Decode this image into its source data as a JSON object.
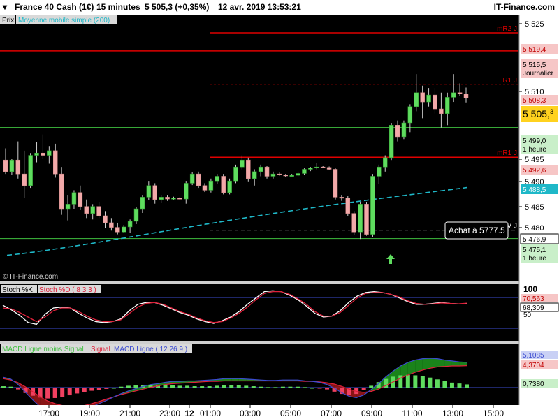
{
  "header": {
    "instrument": "France 40 Cash (1€)",
    "timeframe": "15 minutes",
    "quote": "5 505,3 (+0,35%)",
    "datetime": "12 avr. 2019 13:53:21",
    "brand": "IT-Finance.com"
  },
  "price_panel": {
    "tag": "Prix",
    "indicator_label": "Moyenne mobile simple (200)",
    "watermark": "© IT-Finance.com",
    "buy_label": "Achat à 5777.5",
    "buy_arrow_icon": "up-arrow-icon"
  },
  "stoch_panel": {
    "k_label": "Stoch %K",
    "d_label": "Stoch %D ( 8 3 3 )"
  },
  "macd_panel": {
    "hist_label": "MACD Ligne moins Signal",
    "signal_label": "Signal",
    "macd_label": "MACD Ligne ( 12 26 9 )"
  },
  "colors": {
    "up": "#5fdc5f",
    "down": "#f2a9a9",
    "resistance": "#e00000",
    "support": "#3fbf3f",
    "sma": "#1fb8c8",
    "stoch_k": "#ffffff",
    "stoch_d": "#e0203a",
    "macd_line": "#3b4bd0",
    "macd_signal": "#e0203a",
    "hist_up": "#5fdc5f",
    "hist_down": "#f04060"
  },
  "chart_data": [
    {
      "type": "candlestick",
      "ylim": [
        5470,
        5528
      ],
      "ytick_labels": [
        "5 525",
        "5 510",
        "5 495",
        "5 490",
        "5 485",
        "5 480"
      ],
      "xtick_labels": [
        "17:00",
        "19:00",
        "21:00",
        "23:00",
        "12",
        "01:00",
        "03:00",
        "05:00",
        "07:00",
        "09:00",
        "11:00",
        "13:00",
        "15:00"
      ],
      "candles": [
        [
          5492.0,
          5494.5,
          5489.0,
          5489.5
        ],
        [
          5489.5,
          5492.2,
          5488.8,
          5492.0
        ],
        [
          5492.0,
          5496.0,
          5488.0,
          5489.0
        ],
        [
          5489.0,
          5494.0,
          5483.8,
          5486.5
        ],
        [
          5486.5,
          5493.5,
          5486.0,
          5493.0
        ],
        [
          5493.0,
          5495.8,
          5491.5,
          5493.5
        ],
        [
          5493.5,
          5497.5,
          5492.2,
          5493.0
        ],
        [
          5493.0,
          5495.0,
          5491.2,
          5494.0
        ],
        [
          5494.0,
          5495.5,
          5488.2,
          5489.0
        ],
        [
          5489.0,
          5490.5,
          5480.2,
          5481.5
        ],
        [
          5481.5,
          5484.5,
          5479.0,
          5482.5
        ],
        [
          5482.5,
          5485.5,
          5481.5,
          5485.0
        ],
        [
          5485.0,
          5486.5,
          5481.2,
          5482.0
        ],
        [
          5482.0,
          5483.5,
          5479.5,
          5480.5
        ],
        [
          5480.5,
          5482.5,
          5479.2,
          5482.0
        ],
        [
          5482.0,
          5483.0,
          5479.5,
          5480.0
        ],
        [
          5480.0,
          5481.0,
          5477.4,
          5478.5
        ],
        [
          5478.5,
          5479.5,
          5476.8,
          5477.5
        ],
        [
          5477.5,
          5478.5,
          5476.0,
          5476.5
        ],
        [
          5476.5,
          5478.0,
          5476.4,
          5477.6
        ],
        [
          5477.6,
          5479.2,
          5476.3,
          5478.8
        ],
        [
          5478.8,
          5481.8,
          5478.2,
          5481.5
        ],
        [
          5481.5,
          5484.5,
          5480.6,
          5484.0
        ],
        [
          5484.0,
          5487.5,
          5483.4,
          5486.5
        ],
        [
          5486.5,
          5487.0,
          5482.6,
          5483.5
        ],
        [
          5483.5,
          5484.5,
          5482.8,
          5484.0
        ],
        [
          5484.0,
          5484.5,
          5483.2,
          5483.6
        ],
        [
          5483.6,
          5484.1,
          5483.4,
          5483.8
        ],
        [
          5483.8,
          5484.0,
          5483.5,
          5483.6
        ],
        [
          5483.6,
          5487.5,
          5482.6,
          5487.0
        ],
        [
          5487.0,
          5489.4,
          5486.6,
          5489.0
        ],
        [
          5489.0,
          5489.5,
          5486.0,
          5486.5
        ],
        [
          5486.5,
          5487.0,
          5485.1,
          5485.5
        ],
        [
          5485.5,
          5488.0,
          5485.0,
          5487.5
        ],
        [
          5487.5,
          5489.0,
          5486.8,
          5488.5
        ],
        [
          5488.5,
          5489.0,
          5484.6,
          5485.0
        ],
        [
          5485.0,
          5488.0,
          5484.6,
          5487.5
        ],
        [
          5487.5,
          5491.0,
          5487.0,
          5490.5
        ],
        [
          5490.5,
          5493.0,
          5490.0,
          5492.0
        ],
        [
          5492.0,
          5492.5,
          5487.4,
          5488.0
        ],
        [
          5488.0,
          5490.0,
          5486.5,
          5489.5
        ],
        [
          5489.5,
          5491.0,
          5488.5,
          5490.5
        ],
        [
          5490.5,
          5490.7,
          5488.0,
          5488.5
        ],
        [
          5488.5,
          5489.5,
          5488.0,
          5489.0
        ],
        [
          5489.0,
          5489.3,
          5488.6,
          5488.8
        ],
        [
          5488.8,
          5489.0,
          5488.3,
          5488.6
        ],
        [
          5488.6,
          5489.0,
          5488.5,
          5488.7
        ],
        [
          5488.7,
          5489.5,
          5488.5,
          5489.1
        ],
        [
          5489.1,
          5490.2,
          5488.8,
          5490.0
        ],
        [
          5490.0,
          5490.5,
          5489.6,
          5490.3
        ],
        [
          5490.3,
          5491.3,
          5490.0,
          5490.5
        ],
        [
          5490.5,
          5490.7,
          5490.3,
          5490.4
        ],
        [
          5490.4,
          5490.6,
          5489.8,
          5490.0
        ],
        [
          5490.0,
          5490.2,
          5483.5,
          5484.0
        ],
        [
          5484.0,
          5484.5,
          5483.2,
          5483.8
        ],
        [
          5483.8,
          5484.2,
          5480.0,
          5480.5
        ],
        [
          5480.5,
          5481.0,
          5475.8,
          5476.5
        ],
        [
          5476.5,
          5483.0,
          5475.0,
          5482.5
        ],
        [
          5482.5,
          5483.0,
          5475.7,
          5476.0
        ],
        [
          5476.0,
          5489.0,
          5475.4,
          5488.5
        ],
        [
          5488.5,
          5491.0,
          5486.8,
          5490.5
        ],
        [
          5490.5,
          5493.0,
          5489.5,
          5492.5
        ],
        [
          5492.5,
          5500.0,
          5492.0,
          5499.5
        ],
        [
          5499.5,
          5500.5,
          5496.0,
          5497.0
        ],
        [
          5497.0,
          5500.5,
          5496.5,
          5500.0
        ],
        [
          5500.0,
          5504.0,
          5498.0,
          5503.5
        ],
        [
          5503.5,
          5510.5,
          5502.5,
          5506.5
        ],
        [
          5506.5,
          5508.0,
          5501.0,
          5504.5
        ],
        [
          5504.5,
          5507.5,
          5503.5,
          5506.0
        ],
        [
          5506.0,
          5507.5,
          5502.0,
          5503.0
        ],
        [
          5503.0,
          5506.5,
          5499.0,
          5502.0
        ],
        [
          5502.0,
          5506.5,
          5499.5,
          5505.5
        ],
        [
          5505.5,
          5510.5,
          5504.5,
          5506.5
        ],
        [
          5506.5,
          5508.5,
          5505.8,
          5506.2
        ],
        [
          5506.2,
          5507.6,
          5504.4,
          5505.3
        ]
      ]
    },
    {
      "type": "line",
      "ylim": [
        0,
        100
      ],
      "ytick_labels": [
        "100",
        "50"
      ],
      "value_labels": [
        "70,563",
        "68,309"
      ],
      "series": [
        {
          "name": "Stoch %K",
          "values": [
            66,
            56,
            44,
            28,
            24,
            46,
            60,
            62,
            60,
            48,
            38,
            30,
            28,
            30,
            36,
            54,
            68,
            72,
            72,
            66,
            58,
            50,
            44,
            36,
            30,
            26,
            32,
            40,
            52,
            68,
            82,
            96,
            98,
            96,
            88,
            78,
            64,
            48,
            40,
            42,
            54,
            72,
            86,
            94,
            96,
            94,
            90,
            82,
            74,
            68,
            68,
            70,
            72,
            70,
            69,
            69
          ]
        },
        {
          "name": "Stoch %D",
          "values": [
            60,
            58,
            50,
            40,
            30,
            40,
            54,
            60,
            60,
            52,
            42,
            34,
            30,
            30,
            34,
            48,
            62,
            70,
            72,
            68,
            60,
            52,
            46,
            38,
            32,
            28,
            30,
            38,
            48,
            62,
            78,
            92,
            96,
            96,
            90,
            80,
            68,
            52,
            42,
            42,
            50,
            66,
            82,
            92,
            94,
            94,
            90,
            84,
            76,
            70,
            68,
            69,
            71,
            70,
            69,
            70.563
          ]
        }
      ]
    },
    {
      "type": "bar",
      "value_labels": [
        "5,1085",
        "4,3704",
        "0,7380"
      ],
      "series": [
        {
          "name": "MACD Ligne moins Signal",
          "values": [
            0.3,
            0.2,
            -0.4,
            -1.2,
            -1.8,
            -2.2,
            -2.4,
            -2.3,
            -2.0,
            -1.7,
            -1.3,
            -1.0,
            -0.7,
            -0.5,
            -0.3,
            0.0,
            0.2,
            0.4,
            0.5,
            0.6,
            0.6,
            0.5,
            0.5,
            0.5,
            0.4,
            0.4,
            0.3,
            0.3,
            0.3,
            0.4,
            0.5,
            0.5,
            0.5,
            0.4,
            0.3,
            0.2,
            0.1,
            0.1,
            0.2,
            0.2,
            0.2,
            0.1,
            0.0,
            -0.1,
            -0.4,
            -0.9,
            -1.4,
            -1.6,
            -1.4,
            -0.6,
            0.4,
            1.2,
            1.9,
            2.4,
            2.7,
            2.8,
            2.7,
            2.5,
            2.2,
            1.8,
            1.4,
            1.1,
            0.9,
            0.7
          ]
        },
        {
          "name": "Signal",
          "values": [
            1.5,
            1.2,
            0.6,
            -0.3,
            -1.4,
            -2.5,
            -3.4,
            -4.0,
            -4.4,
            -4.6,
            -4.6,
            -4.4,
            -4.0,
            -3.5,
            -3.0,
            -2.5,
            -2.0,
            -1.6,
            -1.2,
            -0.8,
            -0.4,
            -0.1,
            0.2,
            0.4,
            0.5,
            0.6,
            0.7,
            0.8,
            0.9,
            0.9,
            1.0,
            1.0,
            1.0,
            1.0,
            1.0,
            1.0,
            1.0,
            1.0,
            1.0,
            1.0,
            1.0,
            0.9,
            0.9,
            0.8,
            0.6,
            0.3,
            -0.2,
            -0.8,
            -1.3,
            -1.5,
            -1.3,
            -0.8,
            0.0,
            0.8,
            1.6,
            2.3,
            2.9,
            3.4,
            3.8,
            4.1,
            4.2,
            4.3,
            4.3,
            4.3704
          ]
        },
        {
          "name": "MACD Ligne",
          "values": [
            1.8,
            1.4,
            0.2,
            -1.5,
            -3.2,
            -4.7,
            -5.8,
            -6.3,
            -6.4,
            -6.3,
            -5.9,
            -5.4,
            -4.7,
            -4.0,
            -3.3,
            -2.5,
            -1.8,
            -1.2,
            -0.7,
            -0.2,
            0.2,
            0.4,
            0.7,
            0.9,
            0.9,
            1.0,
            1.0,
            1.1,
            1.2,
            1.3,
            1.5,
            1.5,
            1.5,
            1.4,
            1.3,
            1.2,
            1.1,
            1.1,
            1.2,
            1.2,
            1.2,
            1.0,
            0.9,
            0.7,
            0.2,
            -0.6,
            -1.6,
            -2.4,
            -2.7,
            -2.1,
            -0.9,
            0.4,
            1.9,
            3.2,
            4.3,
            5.1,
            5.6,
            5.9,
            6.0,
            5.9,
            5.6,
            5.4,
            5.2,
            5.1085
          ]
        }
      ]
    }
  ],
  "levels": [
    {
      "label": "mR2 J",
      "value": 5519.4,
      "value_label": "5 519,4",
      "style": "solid",
      "color_key": "resistance",
      "left": "mid"
    },
    {
      "label": "",
      "value": 5515.5,
      "value_label": "5 515,5",
      "sub_label": "Journalier",
      "style": "solid",
      "color_key": "resistance",
      "left": "full"
    },
    {
      "label": "R1 J",
      "value": 5508.3,
      "value_label": "5 508,3",
      "style": "dashed",
      "color_key": "resistance",
      "left": "mid"
    },
    {
      "label": "",
      "value": 5505.3,
      "value_label": "5 505,",
      "value_label_suffix": "3",
      "style": "none",
      "color_key": "current",
      "left": "none"
    },
    {
      "label": "",
      "value": 5499.0,
      "value_label": "5 499,0",
      "sub_label": "1 heure",
      "style": "solid",
      "color_key": "support",
      "left": "full"
    },
    {
      "label": "mR1 J",
      "value": 5492.6,
      "value_label": "5 492,6",
      "style": "solid",
      "color_key": "resistance",
      "left": "mid"
    },
    {
      "label": "",
      "value": 5488.5,
      "value_label": "5 488,5",
      "style": "none",
      "color_key": "sma",
      "left": "none"
    },
    {
      "label": "PIV J",
      "value": 5476.9,
      "value_label": "5 476,9",
      "style": "dashed-white",
      "color_key": "pivot",
      "left": "mid"
    },
    {
      "label": "",
      "value": 5475.1,
      "value_label": "5 475,1",
      "sub_label": "1 heure",
      "style": "solid",
      "color_key": "support",
      "left": "full"
    }
  ]
}
